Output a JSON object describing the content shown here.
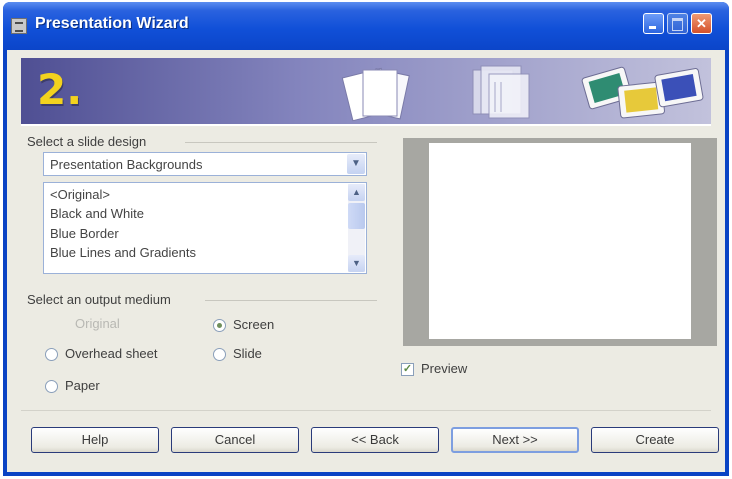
{
  "window": {
    "title": "Presentation Wizard",
    "step_number": "2."
  },
  "design": {
    "section_label": "Select a slide design",
    "combo_value": "Presentation Backgrounds",
    "list_items": [
      "<Original>",
      "Black and White",
      "Blue Border",
      "Blue Lines and Gradients"
    ]
  },
  "output": {
    "section_label": "Select an output medium",
    "options": {
      "original": "Original",
      "overhead": "Overhead sheet",
      "paper": "Paper",
      "screen": "Screen",
      "slide": "Slide"
    },
    "selected": "Screen"
  },
  "preview": {
    "checkbox_label": "Preview",
    "checked": true
  },
  "buttons": {
    "help": "Help",
    "cancel": "Cancel",
    "back": "<< Back",
    "next": "Next >>",
    "create": "Create"
  },
  "colors": {
    "titlebar": "#0b45c9",
    "step_number": "#f3d21e",
    "dialog_bg": "#ecebe3"
  }
}
